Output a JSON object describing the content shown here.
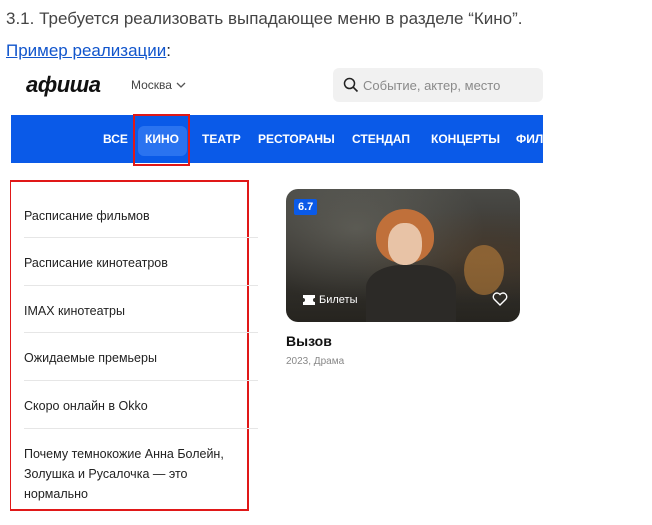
{
  "heading": "3.1. Требуется реализовать выпадающее меню в разделе “Кино”.",
  "example": {
    "link_text": "Пример реализации",
    "suffix": ":"
  },
  "header": {
    "logo": "афиша",
    "city": "Москва",
    "search_placeholder": "Событие, актер, место"
  },
  "nav": {
    "items": [
      {
        "label": "ВСЕ"
      },
      {
        "label": "КИНО",
        "active": true
      },
      {
        "label": "ТЕАТР"
      },
      {
        "label": "РЕСТОРАНЫ"
      },
      {
        "label": "СТЕНДАП"
      },
      {
        "label": "КОНЦЕРТЫ"
      },
      {
        "label": "ФИЛ"
      }
    ]
  },
  "dropdown": {
    "items": [
      {
        "label": "Расписание фильмов"
      },
      {
        "label": "Расписание кинотеатров"
      },
      {
        "label": "IMAX кинотеатры"
      },
      {
        "label": "Ожидаемые премьеры"
      },
      {
        "label": "Скоро онлайн в Okko"
      },
      {
        "label": "Почему темнокожие Анна Болейн, Золушка и Русалочка — это нормально"
      }
    ]
  },
  "card": {
    "rating": "6.7",
    "tickets_label": "Билеты",
    "title": "Вызов",
    "meta": "2023, Драма"
  },
  "colors": {
    "brand_blue": "#0a5ae8",
    "highlight_red": "#e01818",
    "link": "#1155cc"
  }
}
